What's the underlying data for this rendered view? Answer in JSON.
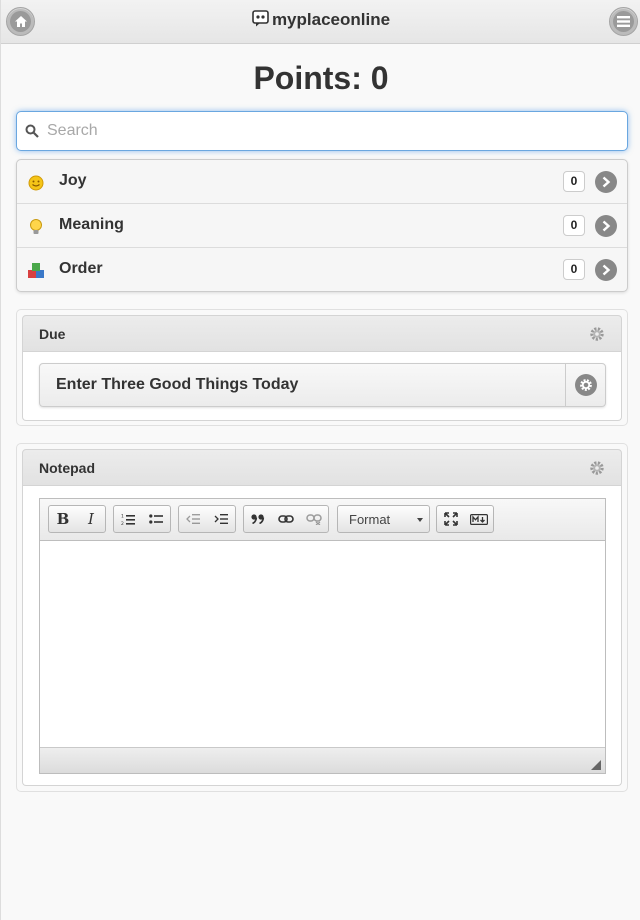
{
  "header": {
    "title": "myplaceonline",
    "home_icon": "home-icon",
    "menu_icon": "menu-icon"
  },
  "points": {
    "label": "Points: 0"
  },
  "search": {
    "placeholder": "Search",
    "value": ""
  },
  "categories": [
    {
      "label": "Joy",
      "count": "0",
      "icon": "smiley-icon"
    },
    {
      "label": "Meaning",
      "count": "0",
      "icon": "lightbulb-icon"
    },
    {
      "label": "Order",
      "count": "0",
      "icon": "blocks-icon"
    }
  ],
  "due": {
    "title": "Due",
    "item": "Enter Three Good Things Today"
  },
  "notepad": {
    "title": "Notepad",
    "format_label": "Format",
    "bold": "B",
    "italic": "I"
  },
  "colors": {
    "accent": "#388ce6",
    "arrow": "#888888",
    "header_bg": "#e9e9e9"
  }
}
